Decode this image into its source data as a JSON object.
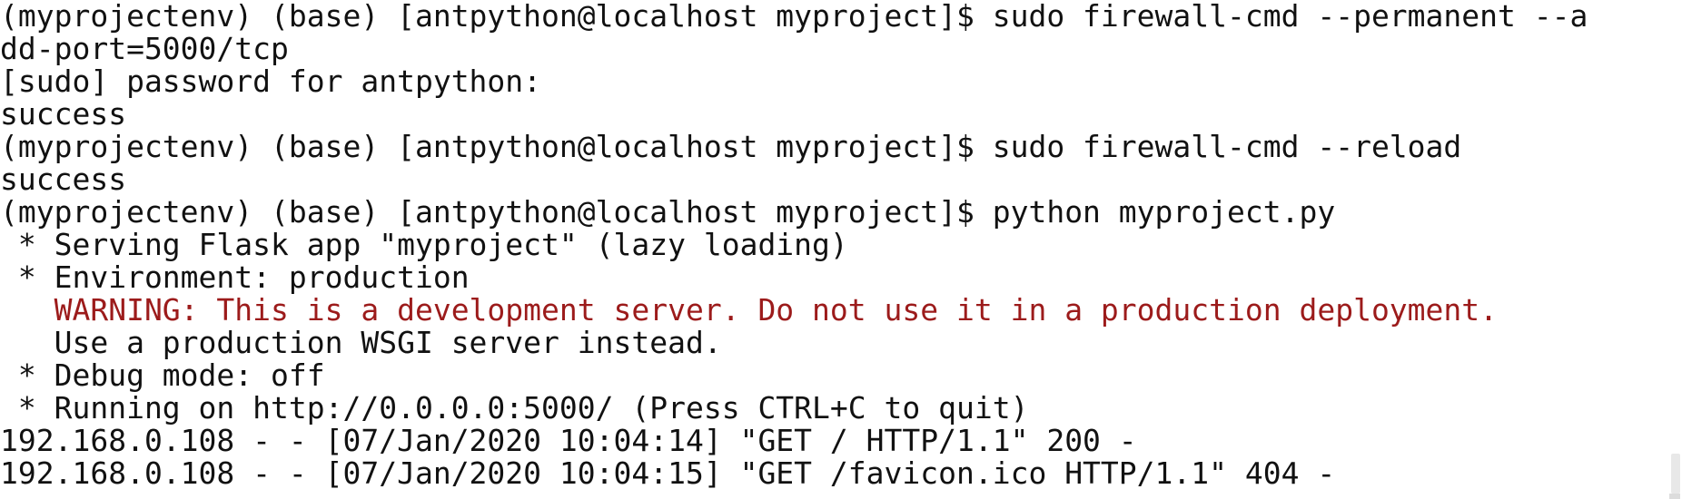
{
  "terminal": {
    "lines": [
      "(myprojectenv) (base) [antpython@localhost myproject]$ sudo firewall-cmd --permanent --a",
      "dd-port=5000/tcp",
      "[sudo] password for antpython:",
      "success",
      "(myprojectenv) (base) [antpython@localhost myproject]$ sudo firewall-cmd --reload",
      "success",
      "(myprojectenv) (base) [antpython@localhost myproject]$ python myproject.py",
      " * Serving Flask app \"myproject\" (lazy loading)",
      " * Environment: production",
      "   WARNING: This is a development server. Do not use it in a production deployment.",
      "   Use a production WSGI server instead.",
      " * Debug mode: off",
      " * Running on http://0.0.0.0:5000/ (Press CTRL+C to quit)",
      "192.168.0.108 - - [07/Jan/2020 10:04:14] \"GET / HTTP/1.1\" 200 -",
      "192.168.0.108 - - [07/Jan/2020 10:04:15] \"GET /favicon.ico HTTP/1.1\" 404 -"
    ],
    "colors": {
      "background": "#ffffff",
      "text": "#111111",
      "warning": "#9c1b1b"
    }
  }
}
